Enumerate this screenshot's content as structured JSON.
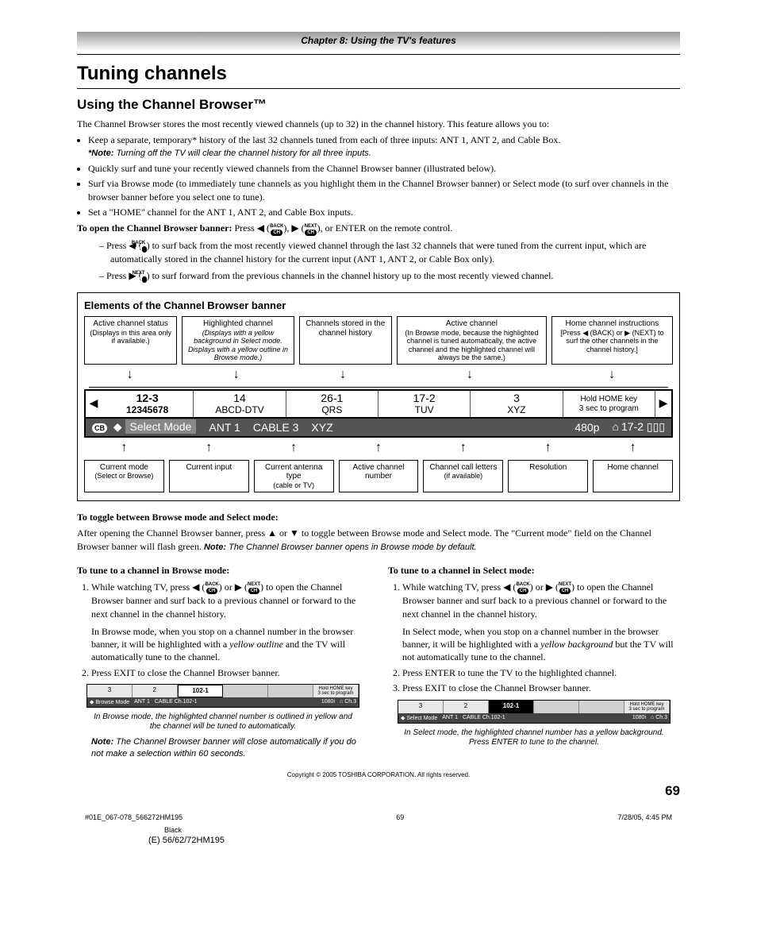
{
  "chapter": "Chapter 8: Using the TV's features",
  "h1": "Tuning channels",
  "h2": "Using the Channel Browser™",
  "intro": "The Channel Browser stores the most recently viewed channels (up to 32) in the channel history. This feature allows you to:",
  "bullets": [
    "Keep a separate, temporary* history of the last 32 channels tuned from each of three inputs: ANT 1, ANT 2, and Cable Box.",
    "Quickly surf and tune your recently viewed channels from the Channel Browser banner (illustrated below).",
    "Surf via Browse mode (to immediately tune channels as you highlight them in the Channel Browser banner) or Select mode (to surf over channels in the browser banner before you select one to tune).",
    "Set a \"HOME\" channel for the ANT 1, ANT 2, and Cable Box inputs."
  ],
  "note1_label": "*Note:",
  "note1": "Turning off the TV will clear the channel history for all three inputs.",
  "open_banner_label": "To open the Channel Browser banner:",
  "open_banner_tail": ", or ENTER on the remote control.",
  "press_word": "Press",
  "or_word": "or",
  "dash1_pre": "– Press",
  "dash1": "to surf back from the most recently viewed channel through the last 32 channels that were tuned from the current input, which are automatically stored in the channel history for the current input (ANT 1, ANT 2, or Cable Box only).",
  "dash2_pre": "– Press",
  "dash2": "to surf forward from the previous channels in the channel history up to the most recently viewed channel.",
  "diagram_title": "Elements of the Channel Browser banner",
  "callouts_top": [
    {
      "t": "Active channel status",
      "d": "(Displays in this area only if available.)"
    },
    {
      "t": "Highlighted channel",
      "d": "(Displays with a yellow background in Select mode. Displays with a yellow outline in Browse mode.)"
    },
    {
      "t": "Channels stored in the channel history",
      "d": ""
    },
    {
      "t": "Active channel",
      "d": "(In Browse mode, because the highlighted channel is tuned automatically, the active channel and the highlighted channel will always be the same.)"
    },
    {
      "t": "Home channel instructions",
      "d": "[Press ◀ (BACK) or ▶ (NEXT) to surf the other channels in the channel history.]"
    }
  ],
  "banner_cells": [
    {
      "num": "12-3",
      "label": "12345678",
      "hl": true
    },
    {
      "num": "14",
      "label": "ABCD-DTV"
    },
    {
      "num": "26-1",
      "label": "QRS"
    },
    {
      "num": "17-2",
      "label": "TUV"
    },
    {
      "num": "3",
      "label": "XYZ"
    }
  ],
  "banner_home": {
    "l1": "Hold HOME key",
    "l2": "3 sec to program"
  },
  "status": {
    "cb": "CB",
    "mode": "Select Mode",
    "input": "ANT 1",
    "ant": "CABLE 3",
    "call": "XYZ",
    "res": "480p",
    "home": "17-2"
  },
  "callouts_bottom": [
    {
      "t": "Current mode",
      "d": "(Select or Browse)"
    },
    {
      "t": "Current input",
      "d": ""
    },
    {
      "t": "Current antenna type",
      "d": "(cable or TV)"
    },
    {
      "t": "Active channel number",
      "d": ""
    },
    {
      "t": "Channel call letters",
      "d": "(if available)"
    },
    {
      "t": "Resolution",
      "d": ""
    },
    {
      "t": "Home channel",
      "d": ""
    }
  ],
  "toggle_title": "To toggle between Browse mode and Select mode:",
  "toggle_body_a": "After opening the Channel Browser banner, press ▲ or ▼ to toggle between Browse mode and Select mode.  The \"Current mode\" field on the Channel Browser banner will flash green.  ",
  "toggle_note_label": "Note:",
  "toggle_note": "The Channel Browser banner opens in Browse mode by default.",
  "left": {
    "title": "To tune to a channel in Browse mode:",
    "step1a": "While watching TV, press",
    "step1b": "to open the Channel Browser banner and surf back to a previous channel or forward to the next channel in the channel history.",
    "para2a": "In Browse mode, when you stop on a channel number in the browser banner, it will be highlighted with a ",
    "para2_it": "yellow outline",
    "para2b": " and the TV will automatically tune to the channel.",
    "step2": "Press EXIT to close the Channel Browser banner.",
    "caption": "In Browse mode, the highlighted channel number is outlined in yellow and the channel will be tuned to automatically.",
    "note_label": "Note:",
    "note": "The Channel Browser banner will close automatically if you do not make a selection within 60 seconds."
  },
  "right": {
    "title": "To tune to a channel in Select mode:",
    "step1a": "While watching TV, press",
    "step1b": "to open the Channel Browser banner and surf back to a previous channel or forward to the next channel in the channel history.",
    "para2a": "In Select mode, when you stop on a channel number in the browser banner, it will be highlighted with a ",
    "para2_it": "yellow background",
    "para2b": " but the TV will not automatically tune to the channel.",
    "step2": "Press ENTER to tune the TV to the highlighted channel.",
    "step3": "Press EXIT to close the Channel Browser banner.",
    "caption": "In Select mode, the highlighted channel number has a yellow background. Press ENTER to tune to the channel."
  },
  "mini": {
    "cells": [
      "3",
      "2",
      "102-1"
    ],
    "home": {
      "l1": "Hold HOME key",
      "l2": "3 sec to program"
    },
    "status_browse": {
      "mode": "Browse Mode",
      "input": "ANT 1",
      "ch": "CABLE   Ch.102-1",
      "res": "1080i",
      "home": "Ch.3"
    },
    "status_select": {
      "mode": "Select Mode",
      "input": "ANT 1",
      "ch": "CABLE   Ch.102-1",
      "res": "1080i",
      "home": "Ch.3"
    }
  },
  "copyright": "Copyright © 2005 TOSHIBA CORPORATION. All rights reserved.",
  "page_num": "69",
  "footer_file": "#01E_067-078_566272HM195",
  "footer_page": "69",
  "footer_date": "7/28/05, 4:45 PM",
  "footer_color": "Black",
  "footer_model": "(E) 56/62/72HM195",
  "btn_back": "BACK",
  "btn_next": "NEXT",
  "btn_inner": "CH"
}
